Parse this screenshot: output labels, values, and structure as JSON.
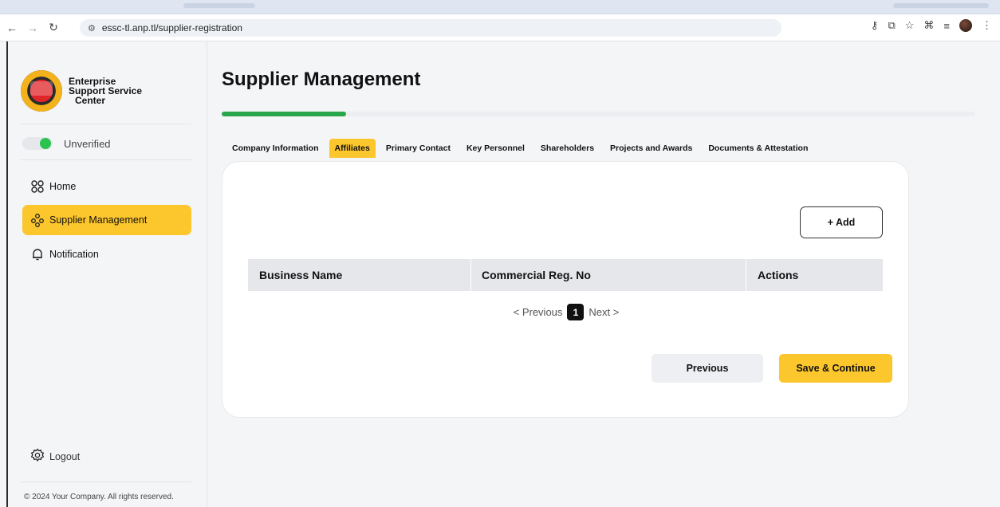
{
  "browser": {
    "url": "essc-tl.anp.tl/supplier-registration"
  },
  "sidebar": {
    "brand_lines": [
      "Enterprise",
      "Support Service",
      "Center"
    ],
    "status_label": "Unverified",
    "items": [
      {
        "label": "Home",
        "icon": "grid-icon"
      },
      {
        "label": "Supplier Management",
        "icon": "network-icon",
        "active": true
      },
      {
        "label": "Notification",
        "icon": "bell-icon"
      }
    ],
    "logout_label": "Logout",
    "copyright": "© 2024 Your Company. All rights reserved."
  },
  "main": {
    "title": "Supplier Management",
    "progress": 0.165,
    "tabs": [
      {
        "label": "Company Information"
      },
      {
        "label": "Affiliates",
        "active": true
      },
      {
        "label": "Primary Contact"
      },
      {
        "label": "Key Personnel"
      },
      {
        "label": "Shareholders"
      },
      {
        "label": "Projects and Awards"
      },
      {
        "label": "Documents & Attestation"
      }
    ],
    "add_label": "+ Add",
    "table": {
      "headers": [
        "Business Name",
        "Commercial Reg. No",
        "Actions"
      ]
    },
    "pager": {
      "prev": "< Previous",
      "page": "1",
      "next": "Next >"
    },
    "previous_label": "Previous",
    "save_label": "Save & Continue"
  },
  "colors": {
    "accent": "#fcc62d",
    "progress": "#27a64a",
    "status_on": "#2bc34f"
  }
}
